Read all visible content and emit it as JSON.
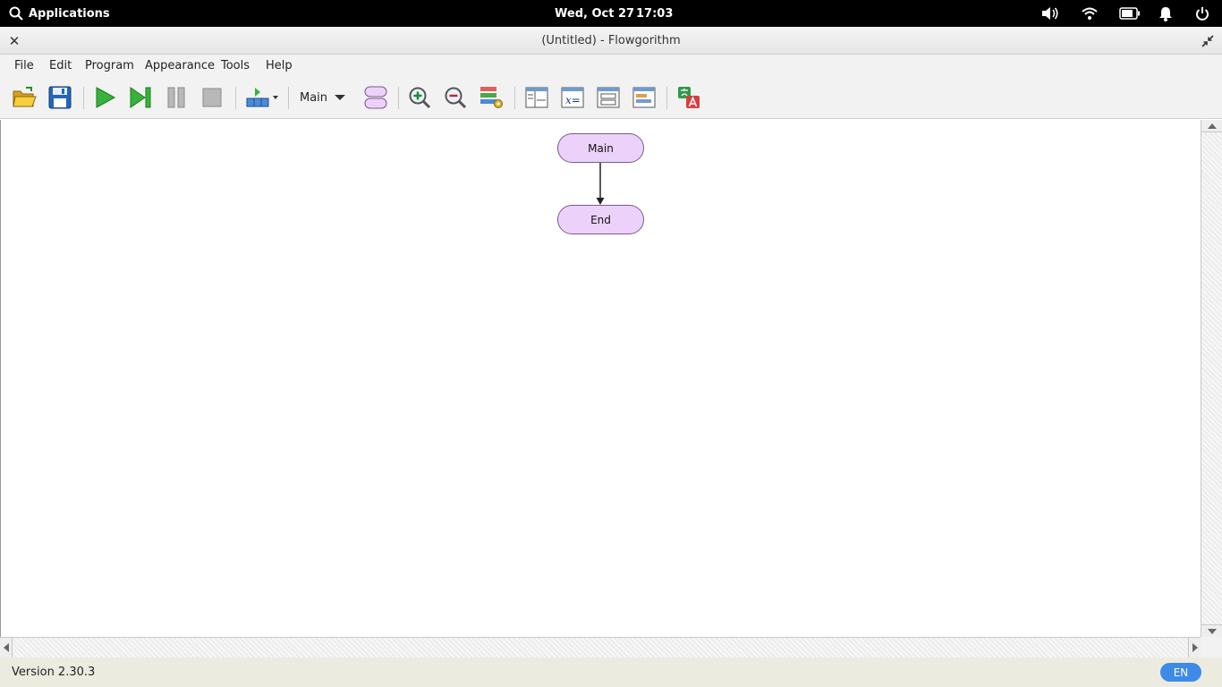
{
  "system_bar": {
    "apps_label": "Applications",
    "date": "Wed, Oct 27",
    "time": "17:03",
    "tray_icons": [
      "volume-icon",
      "wifi-icon",
      "battery-icon",
      "notification-bell-icon",
      "power-icon"
    ]
  },
  "window": {
    "title": "(Untitled) - Flowgorithm",
    "close_glyph": "✕"
  },
  "menu": {
    "items": [
      "File",
      "Edit",
      "Program",
      "Appearance",
      "Tools",
      "Help"
    ]
  },
  "toolbar": {
    "function_select_value": "Main",
    "buttons": [
      "open-folder-icon",
      "save-icon",
      "run-icon",
      "step-icon",
      "pause-icon",
      "stop-icon",
      "speed-icon",
      "function-shape-icon",
      "zoom-in-icon",
      "zoom-out-icon",
      "layout-style-icon",
      "layout-window-icon",
      "variable-watch-icon",
      "console-window-icon",
      "source-code-window-icon",
      "translate-icon"
    ]
  },
  "flowchart": {
    "start_label": "Main",
    "end_label": "End"
  },
  "colors": {
    "node_fill": "#ecd2fb",
    "lang_badge": "#3d8ae8"
  },
  "status": {
    "version": "Version 2.30.3",
    "language": "EN"
  }
}
